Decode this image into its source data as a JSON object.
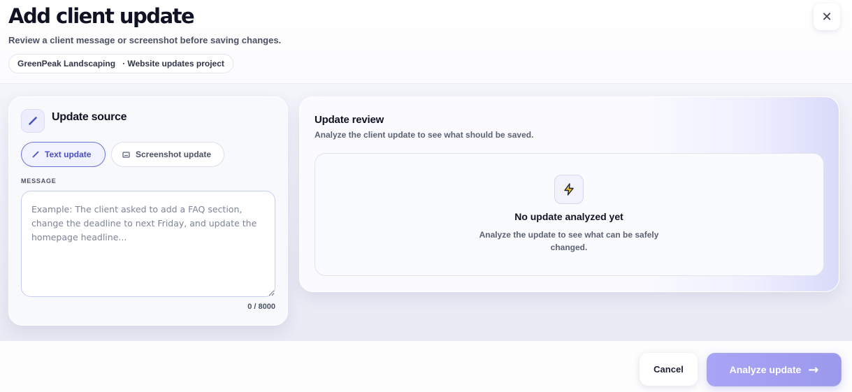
{
  "header": {
    "title": "Add client update",
    "subtitle": "Review a client message or screenshot before saving changes.",
    "client_name": "GreenPeak Landscaping",
    "project": "· Website updates project",
    "close_icon": "✕"
  },
  "source_panel": {
    "icon": "pencil-icon",
    "title": "Update source",
    "tabs": [
      {
        "label": "Text update",
        "icon": "pencil-icon",
        "active": true
      },
      {
        "label": "Screenshot update",
        "icon": "image-icon",
        "active": false
      }
    ],
    "message_label": "MESSAGE",
    "message_value": "",
    "message_placeholder": "Example: The client asked to add a FAQ section, change the deadline to next Friday, and update the homepage headline...",
    "counter": "0 / 8000"
  },
  "review_panel": {
    "title": "Update review",
    "subtitle": "Analyze the client update to see what should be saved.",
    "empty_icon": "lightning-icon",
    "empty_title": "No update analyzed yet",
    "empty_desc": "Analyze the update to see what can be safely changed."
  },
  "footer": {
    "cancel_label": "Cancel",
    "analyze_label": "Analyze update",
    "analyze_arrow": "→"
  },
  "colors": {
    "accent": "#4a4fc6",
    "accent_button": "#a9a4f6",
    "bolt": "#f2c230"
  }
}
